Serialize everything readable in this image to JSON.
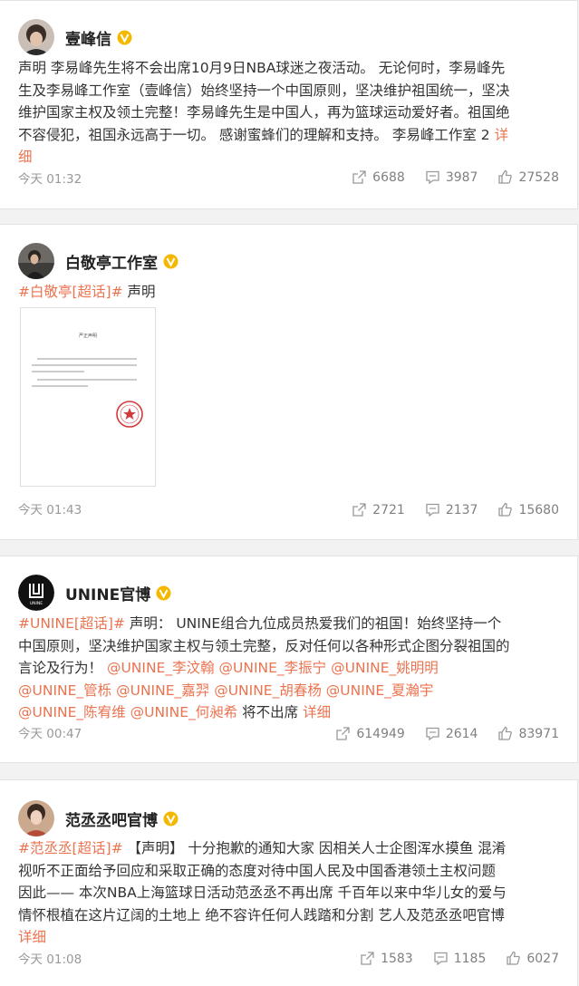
{
  "posts": [
    {
      "author": "壹峰信",
      "lines": [
        [
          "声明  李易峰先生将不会出席10月9日NBA球迷之夜活动。 无论何时，李易峰先"
        ],
        [
          "生及李易峰工作室（壹峰信）始终坚持一个中国原则，坚决维护祖国统一，坚决"
        ],
        [
          "维护国家主权及领土完整！李易峰先生是中国人，再为篮球运动爱好者。祖国绝"
        ],
        [
          "不容侵犯，祖国永远高于一切。  感谢蜜蜂们的理解和支持。  李易峰工作室 2 "
        ]
      ],
      "more": "详细",
      "more_line": "细",
      "time": "今天 01:32",
      "reposts": "6688",
      "comments": "3987",
      "likes": "27528"
    },
    {
      "author": "白敬亭工作室",
      "tag": "#白敬亭[超话]#",
      "rest": " 声明",
      "doc_title": "严正声明",
      "time": "今天 01:43",
      "reposts": "2721",
      "comments": "2137",
      "likes": "15680"
    },
    {
      "author": "UNINE官博",
      "avatar_text": "UNINE",
      "tag": "#UNINE[超话]#",
      "line1_rest": " 声明： UNINE组合九位成员热爱我们的祖国！始终坚持一个",
      "line2": "中国原则，坚决维护国家主权与领土完整，反对任何以各种形式企图分裂祖国的",
      "line3_start": "言论及行为！ ",
      "mentions": [
        "@UNINE_李汶翰",
        "@UNINE_李振宁",
        "@UNINE_姚明明",
        "@UNINE_管栎",
        "@UNINE_嘉羿",
        "@UNINE_胡春杨",
        "@UNINE_夏瀚宇",
        "@UNINE_陈宥维",
        "@UNINE_何昶希"
      ],
      "tail": " 将不出席 ",
      "more": "详细",
      "time": "今天 00:47",
      "reposts": "614949",
      "comments": "2614",
      "likes": "83971"
    },
    {
      "author": "范丞丞吧官博",
      "tag": "#范丞丞[超话]#",
      "line1_rest": " 【声明】 十分抱歉的通知大家 因相关人士企图浑水摸鱼 混淆",
      "line2": "视听不正面给予回应和采取正确的态度对待中国人民及中国香港领土主权问题",
      "line3": "因此—— 本次NBA上海篮球日活动范丞丞不再出席 千百年以来中华儿女的爱与",
      "line4": "情怀根植在这片辽阔的土地上 绝不容许任何人践踏和分割 艺人及范丞丞吧官博",
      "more": "详细",
      "time": "今天 01:08",
      "reposts": "1583",
      "comments": "1185",
      "likes": "6027"
    }
  ],
  "colors": {
    "link": "#eb7350",
    "verified": "#f5b800"
  },
  "icons": {
    "repost": "repost-icon",
    "comment": "comment-icon",
    "like": "like-icon",
    "verified": "verified-badge-icon"
  }
}
